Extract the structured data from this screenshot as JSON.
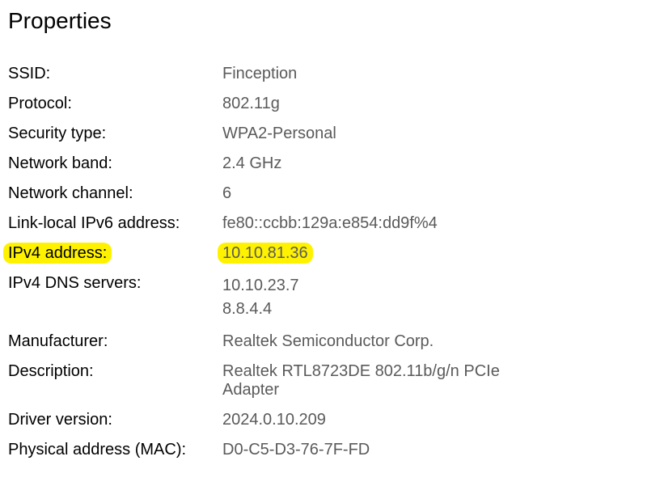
{
  "heading": "Properties",
  "rows": {
    "ssid": {
      "label": "SSID:",
      "value": "Finception"
    },
    "protocol": {
      "label": "Protocol:",
      "value": "802.11g"
    },
    "security_type": {
      "label": "Security type:",
      "value": "WPA2-Personal"
    },
    "network_band": {
      "label": "Network band:",
      "value": "2.4 GHz"
    },
    "network_channel": {
      "label": "Network channel:",
      "value": "6"
    },
    "link_local_ipv6": {
      "label": "Link-local IPv6 address:",
      "value": "fe80::ccbb:129a:e854:dd9f%4"
    },
    "ipv4_address": {
      "label": "IPv4 address:",
      "value": "10.10.81.36"
    },
    "ipv4_dns": {
      "label": "IPv4 DNS servers:",
      "value1": "10.10.23.7",
      "value2": "8.8.4.4"
    },
    "manufacturer": {
      "label": "Manufacturer:",
      "value": "Realtek Semiconductor Corp."
    },
    "description": {
      "label": "Description:",
      "value": "Realtek RTL8723DE 802.11b/g/n PCIe Adapter"
    },
    "driver_version": {
      "label": "Driver version:",
      "value": "2024.0.10.209"
    },
    "mac": {
      "label": "Physical address (MAC):",
      "value": "D0-C5-D3-76-7F-FD"
    }
  }
}
